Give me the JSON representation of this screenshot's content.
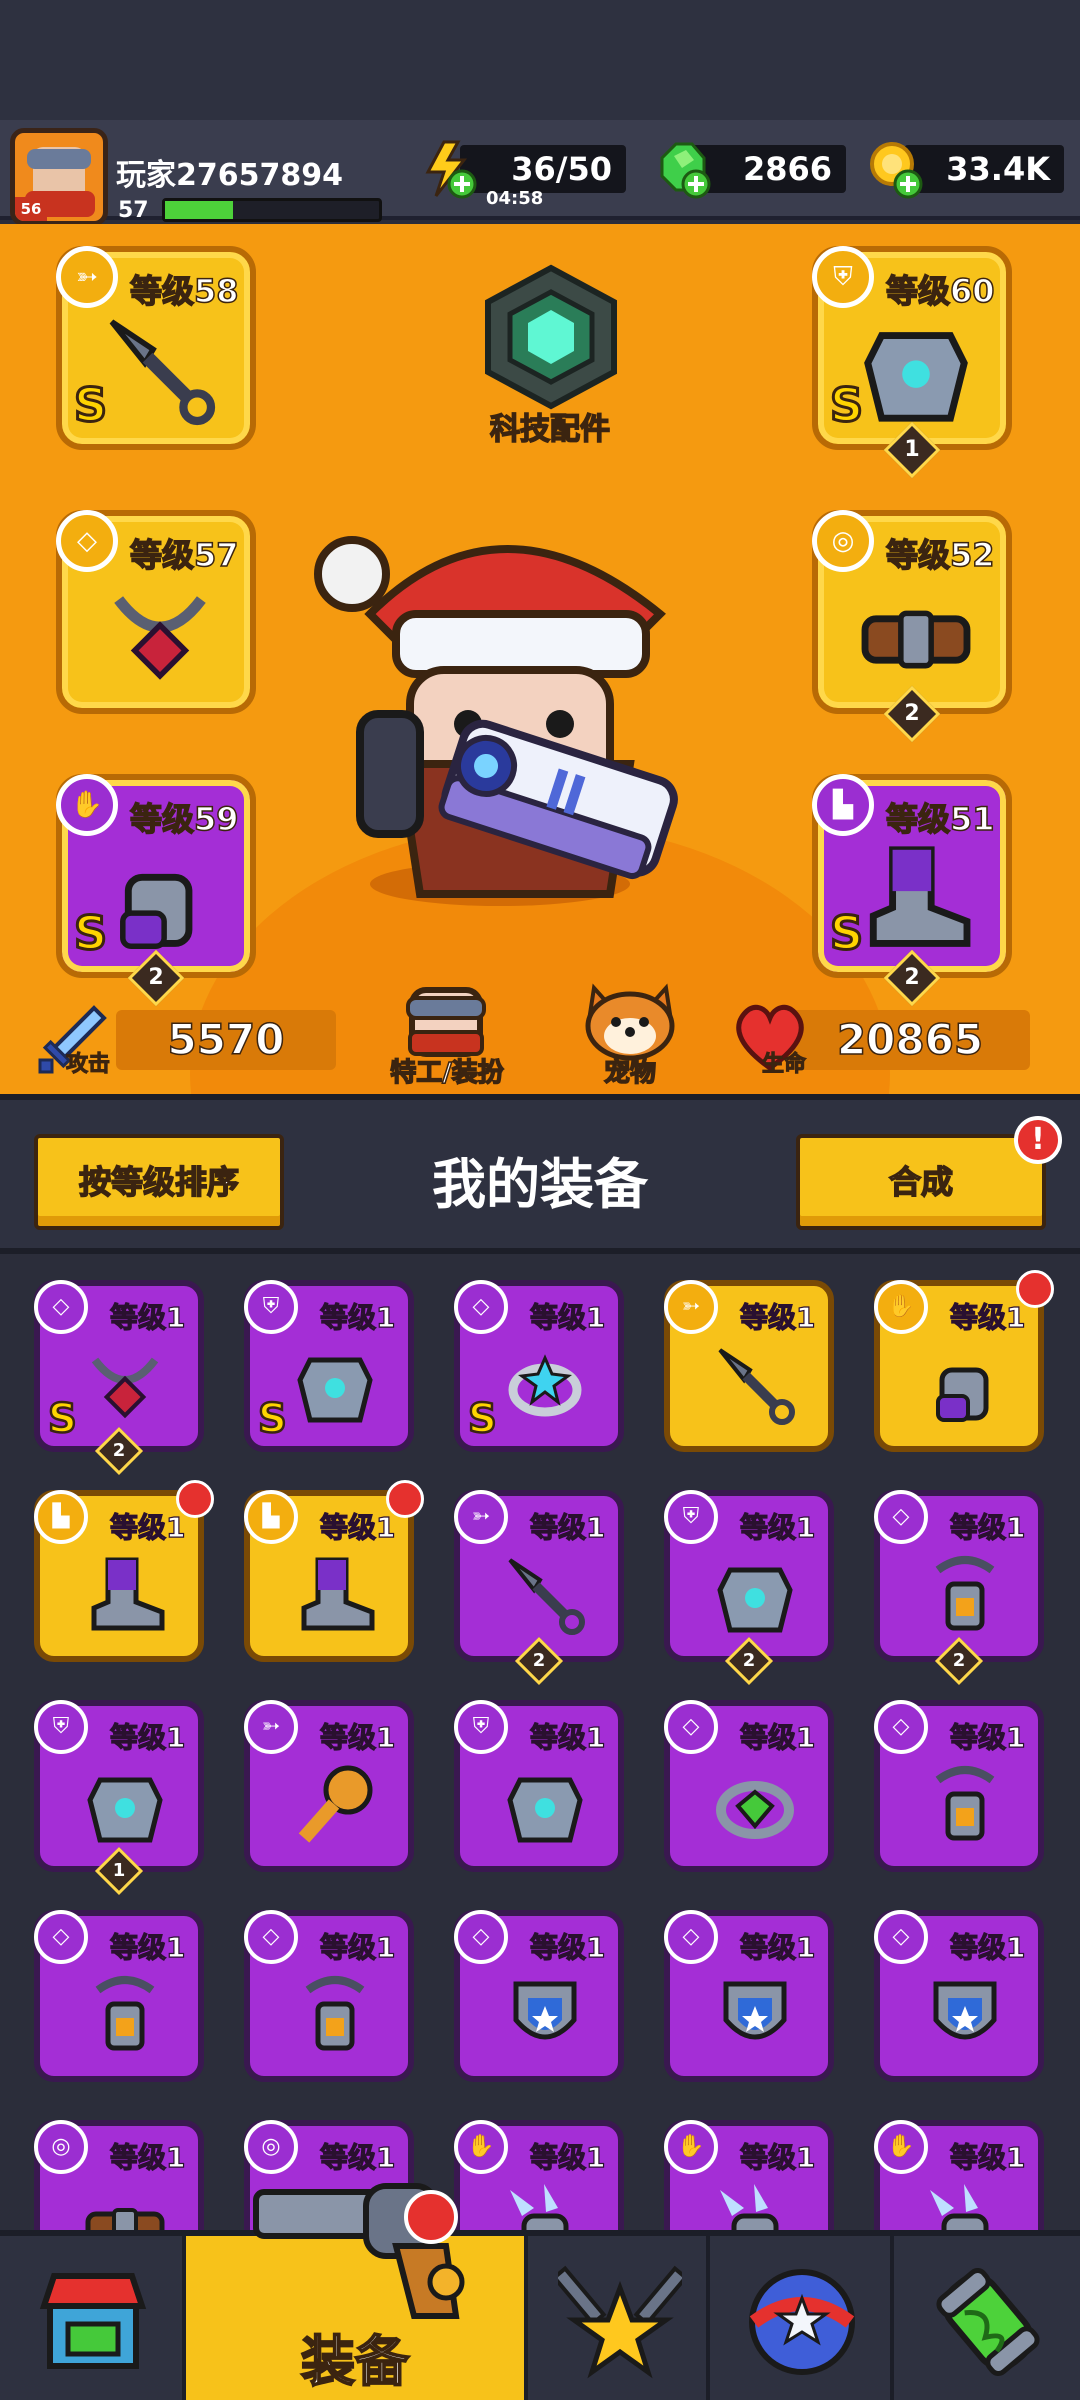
{
  "header": {
    "player_name": "玩家27657894",
    "avatar_level": "56",
    "player_level": "57",
    "xp_fraction": 0.32,
    "energy": "36/50",
    "energy_timer": "04:58",
    "gems": "2866",
    "coins": "33.4K"
  },
  "hero": {
    "tech_parts_label": "科技配件",
    "left_slots": [
      {
        "level": "等级58",
        "grade": "S",
        "stars": "",
        "type_icon": "weapon-icon",
        "color": "gold"
      },
      {
        "level": "等级57",
        "grade": "",
        "stars": "",
        "type_icon": "necklace-icon",
        "color": "gold"
      },
      {
        "level": "等级59",
        "grade": "S",
        "stars": "2",
        "type_icon": "glove-icon",
        "color": "purple"
      }
    ],
    "right_slots": [
      {
        "level": "等级60",
        "grade": "S",
        "stars": "1",
        "type_icon": "armor-icon",
        "color": "gold"
      },
      {
        "level": "等级52",
        "grade": "",
        "stars": "2",
        "type_icon": "belt-icon",
        "color": "gold"
      },
      {
        "level": "等级51",
        "grade": "S",
        "stars": "2",
        "type_icon": "boot-icon",
        "color": "purple"
      }
    ],
    "attack_label": "攻击",
    "attack_value": "5570",
    "agent_label": "特工/装扮",
    "pet_label": "宠物",
    "hp_label": "生命",
    "hp_value": "20865"
  },
  "toolbar": {
    "sort_label": "按等级排序",
    "title": "我的装备",
    "merge_label": "合成",
    "alert": "!"
  },
  "inventory": [
    {
      "level": "等级1",
      "color": "purple",
      "grade": "S",
      "stars": "2",
      "new": false,
      "type": "necklace",
      "art": "necklace"
    },
    {
      "level": "等级1",
      "color": "purple",
      "grade": "S",
      "stars": "",
      "new": false,
      "type": "armor",
      "art": "armor"
    },
    {
      "level": "等级1",
      "color": "purple",
      "grade": "S",
      "stars": "",
      "new": false,
      "type": "necklace",
      "art": "ring"
    },
    {
      "level": "等级1",
      "color": "gold",
      "grade": "",
      "stars": "",
      "new": false,
      "type": "weapon",
      "art": "kunai"
    },
    {
      "level": "等级1",
      "color": "gold",
      "grade": "",
      "stars": "",
      "new": true,
      "type": "glove",
      "art": "glove"
    },
    {
      "level": "等级1",
      "color": "gold",
      "grade": "",
      "stars": "",
      "new": true,
      "type": "boot",
      "art": "boot"
    },
    {
      "level": "等级1",
      "color": "gold",
      "grade": "",
      "stars": "",
      "new": true,
      "type": "boot",
      "art": "boot"
    },
    {
      "level": "等级1",
      "color": "purple",
      "grade": "",
      "stars": "2",
      "new": false,
      "type": "weapon",
      "art": "kunai"
    },
    {
      "level": "等级1",
      "color": "purple",
      "grade": "",
      "stars": "2",
      "new": false,
      "type": "armor",
      "art": "armor"
    },
    {
      "level": "等级1",
      "color": "purple",
      "grade": "",
      "stars": "2",
      "new": false,
      "type": "necklace",
      "art": "lock"
    },
    {
      "level": "等级1",
      "color": "purple",
      "grade": "",
      "stars": "1",
      "new": false,
      "type": "armor",
      "art": "armor"
    },
    {
      "level": "等级1",
      "color": "purple",
      "grade": "",
      "stars": "",
      "new": false,
      "type": "weapon",
      "art": "mic"
    },
    {
      "level": "等级1",
      "color": "purple",
      "grade": "",
      "stars": "",
      "new": false,
      "type": "armor",
      "art": "armor"
    },
    {
      "level": "等级1",
      "color": "purple",
      "grade": "",
      "stars": "",
      "new": false,
      "type": "necklace",
      "art": "gemring"
    },
    {
      "level": "等级1",
      "color": "purple",
      "grade": "",
      "stars": "",
      "new": false,
      "type": "necklace",
      "art": "lock"
    },
    {
      "level": "等级1",
      "color": "purple",
      "grade": "",
      "stars": "",
      "new": false,
      "type": "necklace",
      "art": "lock"
    },
    {
      "level": "等级1",
      "color": "purple",
      "grade": "",
      "stars": "",
      "new": false,
      "type": "necklace",
      "art": "lock"
    },
    {
      "level": "等级1",
      "color": "purple",
      "grade": "",
      "stars": "",
      "new": false,
      "type": "necklace",
      "art": "badge"
    },
    {
      "level": "等级1",
      "color": "purple",
      "grade": "",
      "stars": "",
      "new": false,
      "type": "necklace",
      "art": "badge"
    },
    {
      "level": "等级1",
      "color": "purple",
      "grade": "",
      "stars": "",
      "new": false,
      "type": "necklace",
      "art": "badge"
    },
    {
      "level": "等级1",
      "color": "purple",
      "grade": "",
      "stars": "",
      "new": false,
      "type": "belt",
      "art": "belt"
    },
    {
      "level": "等级1",
      "color": "purple",
      "grade": "",
      "stars": "",
      "new": false,
      "type": "belt",
      "art": "belt"
    },
    {
      "level": "等级1",
      "color": "purple",
      "grade": "",
      "stars": "",
      "new": false,
      "type": "glove",
      "art": "claw"
    },
    {
      "level": "等级1",
      "color": "purple",
      "grade": "",
      "stars": "",
      "new": false,
      "type": "glove",
      "art": "claw"
    },
    {
      "level": "等级1",
      "color": "purple",
      "grade": "",
      "stars": "",
      "new": false,
      "type": "glove",
      "art": "claw"
    }
  ],
  "nav": {
    "tabs": [
      {
        "name": "shop",
        "icon": "shop-icon"
      },
      {
        "name": "equipment",
        "label": "装备",
        "icon": "revolver-icon",
        "active": true
      },
      {
        "name": "battle",
        "icon": "crossed-swords-star-icon"
      },
      {
        "name": "skills",
        "icon": "star-ball-icon"
      },
      {
        "name": "lab",
        "icon": "dna-capsule-icon"
      }
    ]
  },
  "colors": {
    "gold_card": "#f7c21a",
    "purple_card": "#a42ed6",
    "hero_bg": "#f59a10",
    "panel_bg": "#2e3140"
  }
}
